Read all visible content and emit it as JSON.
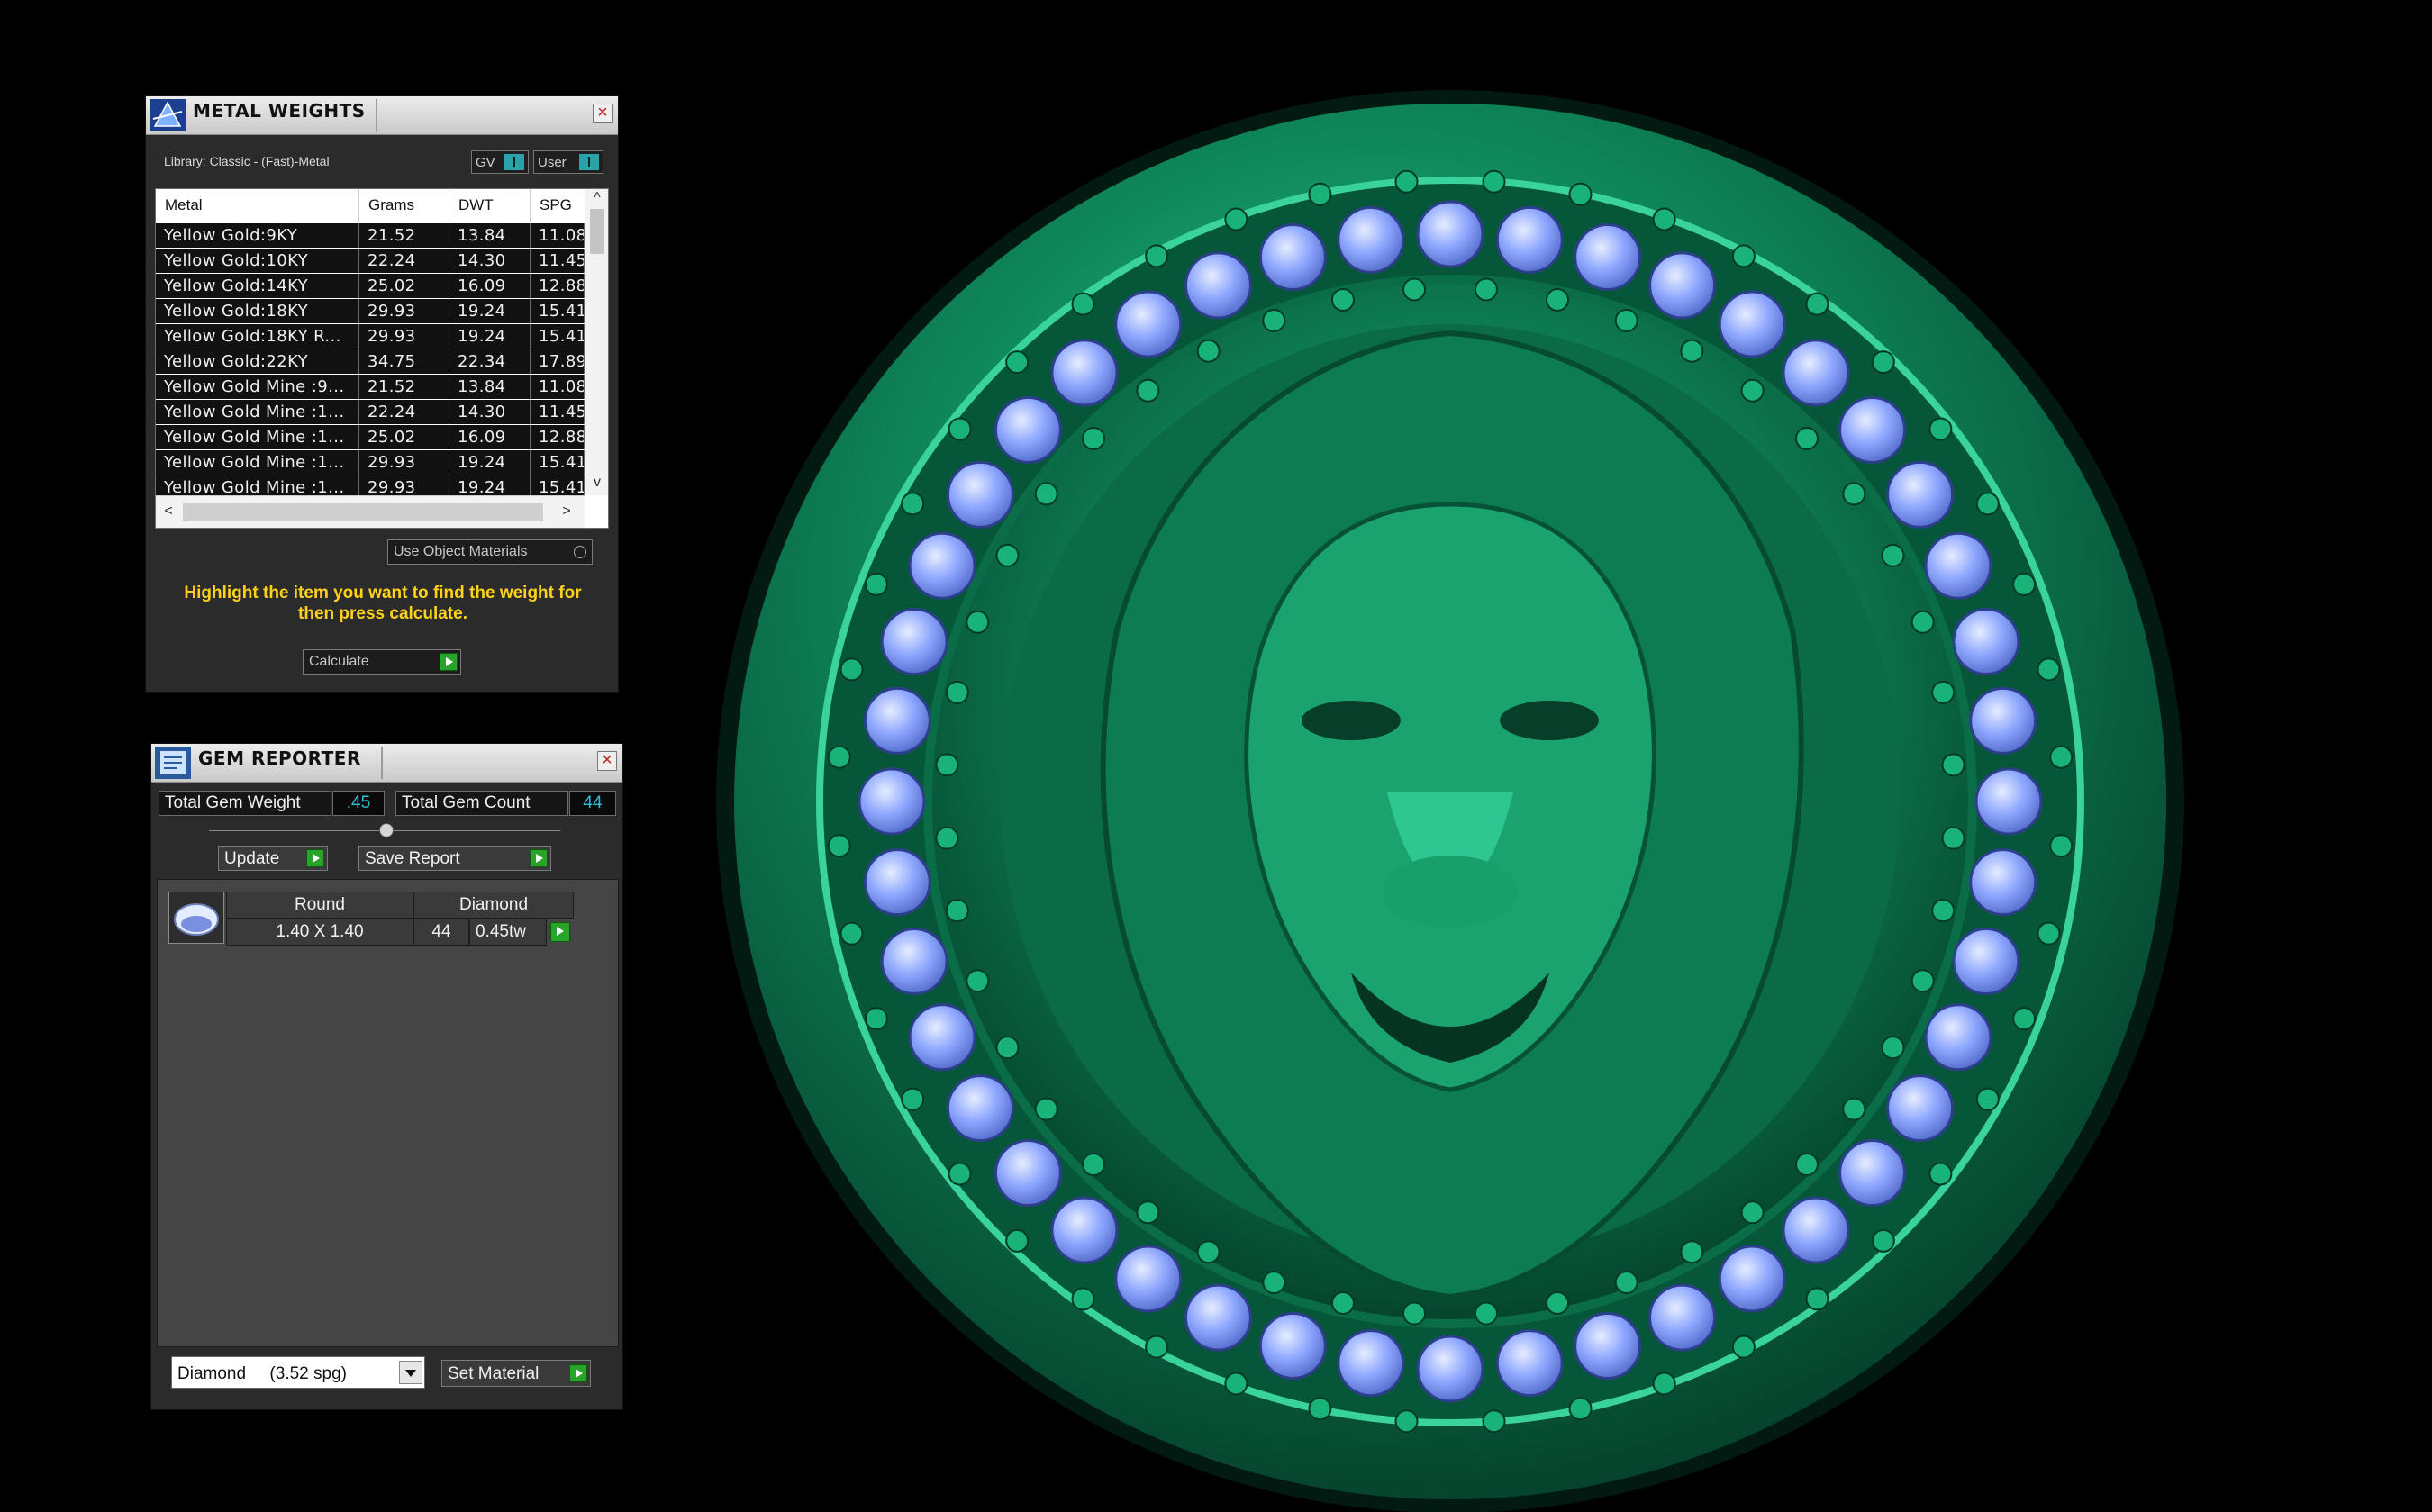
{
  "metal_weights": {
    "title": "METAL WEIGHTS",
    "library": "Library: Classic - (Fast)-Metal",
    "toggle_gv": "GV",
    "toggle_user": "User",
    "columns": [
      "Metal",
      "Grams",
      "DWT",
      "SPG"
    ],
    "rows": [
      [
        "Yellow Gold:9KY",
        "21.52",
        "13.84",
        "11.08"
      ],
      [
        "Yellow Gold:10KY",
        "22.24",
        "14.30",
        "11.45"
      ],
      [
        "Yellow Gold:14KY",
        "25.02",
        "16.09",
        "12.88"
      ],
      [
        "Yellow Gold:18KY",
        "29.93",
        "19.24",
        "15.41"
      ],
      [
        "Yellow Gold:18KY R...",
        "29.93",
        "19.24",
        "15.41"
      ],
      [
        "Yellow Gold:22KY",
        "34.75",
        "22.34",
        "17.89"
      ],
      [
        "Yellow Gold Mine :9...",
        "21.52",
        "13.84",
        "11.08"
      ],
      [
        "Yellow Gold Mine :1...",
        "22.24",
        "14.30",
        "11.45"
      ],
      [
        "Yellow Gold Mine :1...",
        "25.02",
        "16.09",
        "12.88"
      ],
      [
        "Yellow Gold Mine :1...",
        "29.93",
        "19.24",
        "15.41"
      ],
      [
        "Yellow Gold Mine :1...",
        "29.93",
        "19.24",
        "15.41"
      ]
    ],
    "use_object_materials": "Use Object Materials",
    "hint": "Highlight the item you want to find the weight for then press calculate.",
    "calculate": "Calculate"
  },
  "gem_reporter": {
    "title": "GEM REPORTER",
    "total_weight_label": "Total Gem Weight",
    "total_weight_value": ".45",
    "total_count_label": "Total Gem Count",
    "total_count_value": "44",
    "update": "Update",
    "save_report": "Save Report",
    "gem": {
      "shape": "Round",
      "material": "Diamond",
      "size": "1.40 X 1.40",
      "count": "44",
      "weight": "0.45tw"
    },
    "material_select": "Diamond     (3.52 spg)",
    "set_material": "Set Material"
  },
  "viewport": {
    "label": "3D viewport - lion head signet ring",
    "gem_count_rendered": 44
  },
  "colors": {
    "hint_text": "#ffd21a",
    "value_text": "#29c4d4",
    "metal": "#0e8a5a",
    "gem": "#8fa8ff",
    "play_button": "#28a42a"
  }
}
